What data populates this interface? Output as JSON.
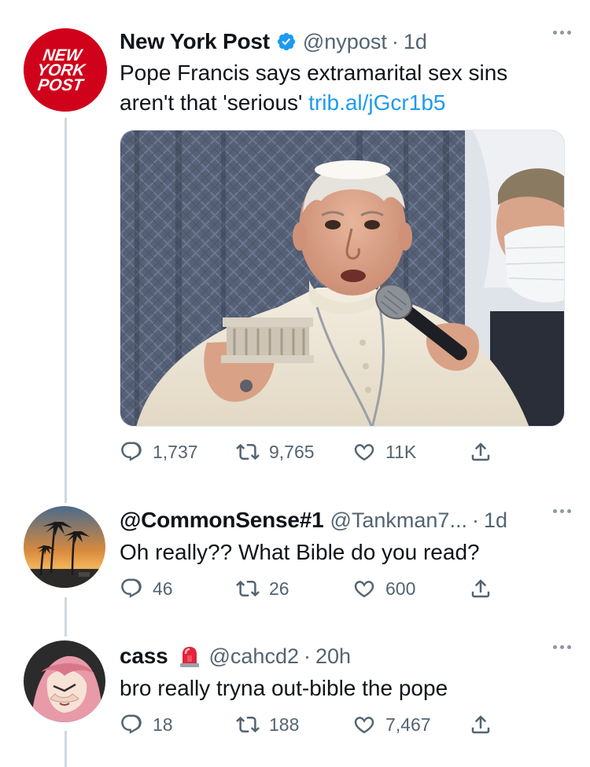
{
  "tweet1": {
    "avatar": {
      "logo_text": [
        "NEW",
        "YORK",
        "POST"
      ],
      "bg_color": "#d0021b"
    },
    "name": "New York Post",
    "handle": "@nypost",
    "dot": "·",
    "time": "1d",
    "text_line1": "Pope Francis says extramarital sex sins",
    "text_line2": "aren't that 'serious'",
    "link": "trib.al/jGcr1b5",
    "replies": "1,737",
    "retweets": "9,765",
    "likes": "11K"
  },
  "tweet2": {
    "name": "@CommonSense#1",
    "handle": "@Tankman7...",
    "dot": "·",
    "time": "1d",
    "text": "Oh really?? What Bible do you read?",
    "replies": "46",
    "retweets": "26",
    "likes": "600"
  },
  "tweet3": {
    "name": "cass",
    "handle": "@cahcd2",
    "dot": "·",
    "time": "20h",
    "text": "bro really tryna out-bible the pope",
    "replies": "18",
    "retweets": "188",
    "likes": "7,467"
  },
  "colors": {
    "link": "#1d9bf0",
    "secondary_text": "#536471",
    "verified": "#1d9bf0",
    "thread_line": "#cfd9de"
  }
}
